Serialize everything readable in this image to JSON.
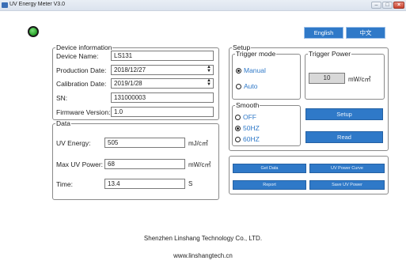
{
  "window": {
    "title": "UV Energy Meter V3.0",
    "minimize_glyph": "–",
    "maximize_glyph": "□",
    "close_glyph": "×"
  },
  "status_led": {
    "color": "#2fb52f",
    "state": "connected"
  },
  "language": {
    "english_label": "English",
    "chinese_label": "中文"
  },
  "device_info": {
    "legend": "Device information",
    "device_name_label": "Device Name:",
    "device_name_value": "LS131",
    "production_date_label": "Production Date:",
    "production_date_value": "2018/12/27",
    "calibration_date_label": "Calibration Date:",
    "calibration_date_value": "2019/1/28",
    "sn_label": "SN:",
    "sn_value": "131000003",
    "firmware_label": "Firmware Version:",
    "firmware_value": "1.0"
  },
  "data_group": {
    "legend": "Data",
    "uv_energy_label": "UV Energy:",
    "uv_energy_value": "505",
    "uv_energy_unit": "mJ/c㎡",
    "max_uv_power_label": "Max UV Power:",
    "max_uv_power_value": "68",
    "max_uv_power_unit": "mW/c㎡",
    "time_label": "Time:",
    "time_value": "13.4",
    "time_unit": "S"
  },
  "setup": {
    "legend": "Setup",
    "trigger_mode": {
      "legend": "Trigger mode",
      "options": [
        "Manual",
        "Auto"
      ],
      "selected": "Manual"
    },
    "trigger_power": {
      "legend": "Trigger Power",
      "value": "10",
      "unit": "mW/c㎡"
    },
    "smooth": {
      "legend": "Smooth",
      "options": [
        "OFF",
        "50HZ",
        "60HZ"
      ],
      "selected": "50HZ"
    },
    "setup_button": "Setup",
    "read_button": "Read"
  },
  "actions": {
    "get_data": "Get Data",
    "uv_power_curve": "UV Power Curve",
    "report": "Report",
    "save_uv_power": "Save UV Power"
  },
  "footer": {
    "company": "Shenzhen Linshang Technology Co., LTD.",
    "website": "www.linshangtech.cn"
  },
  "colors": {
    "accent_blue": "#2f79c8",
    "option_text_blue": "#2f79c8"
  }
}
